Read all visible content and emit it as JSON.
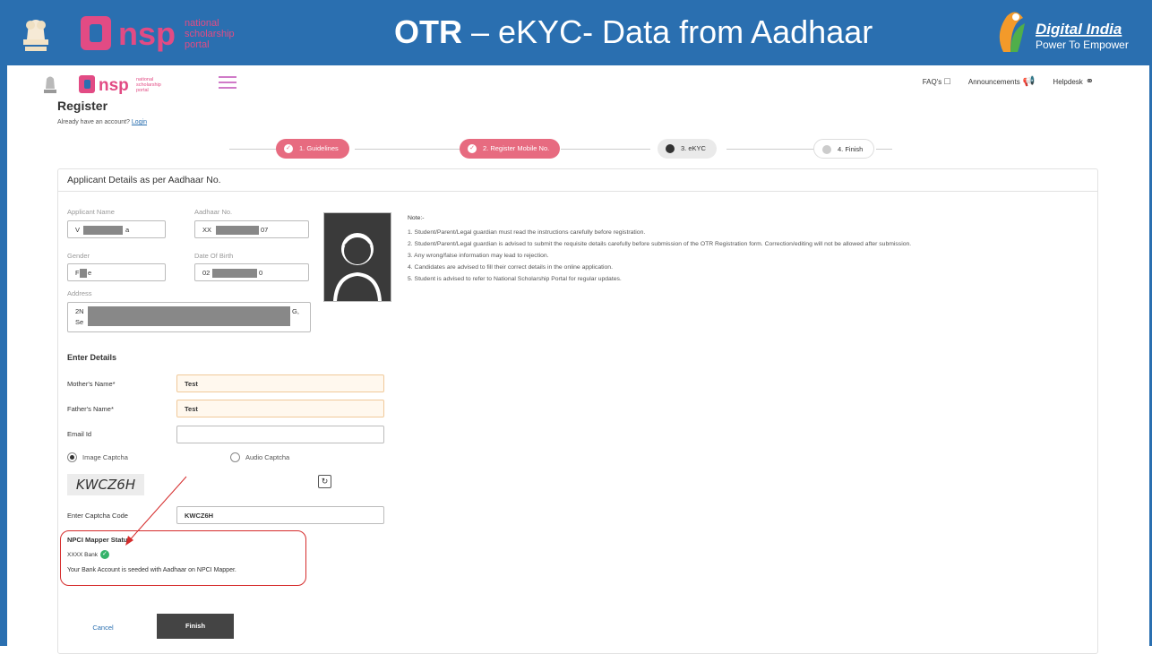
{
  "slide": {
    "title_bold": "OTR",
    "title_rest": " – eKYC- Data from Aadhaar",
    "nsp_brand": "nsp",
    "nsp_tagline_1": "national",
    "nsp_tagline_2": "scholarship",
    "nsp_tagline_3": "portal",
    "di_name": "Digital India",
    "di_tagline": "Power To Empower"
  },
  "nav": {
    "faq": "FAQ's",
    "announcements": "Announcements",
    "helpdesk": "Helpdesk"
  },
  "register": {
    "title": "Register",
    "account_prompt": "Already have an account?",
    "login_link": "Login"
  },
  "steps": [
    {
      "label": "1. Guidelines",
      "state": "done"
    },
    {
      "label": "2. Register Mobile No.",
      "state": "done"
    },
    {
      "label": "3. eKYC",
      "state": "active"
    },
    {
      "label": "4. Finish",
      "state": "todo"
    }
  ],
  "applicant": {
    "heading": "Applicant Details as per Aadhaar No.",
    "name_label": "Applicant Name",
    "name_start": "V",
    "name_end": "a",
    "aadhaar_label": "Aadhaar No.",
    "aadhaar_start": "XX",
    "aadhaar_end": "07",
    "gender_label": "Gender",
    "gender_start": "F",
    "gender_end": "e",
    "dob_label": "Date Of Birth",
    "dob_start": "02",
    "dob_end": "0",
    "address_label": "Address",
    "address_line1_start": "2N",
    "address_line1_end": "G,",
    "address_line2_start": "Se"
  },
  "notes": {
    "heading": "Note:-",
    "items": [
      "1. Student/Parent/Legal guardian must read the instructions carefully before registration.",
      "2. Student/Parent/Legal guardian is advised to submit the requisite details carefully before submission of the OTR Registration form. Correction/editing will not be allowed after submission.",
      "3. Any wrong/false information may lead to rejection.",
      "4. Candidates are advised to fill their correct details in the online application.",
      "5. Student is advised to refer to National Scholarship Portal for regular updates."
    ]
  },
  "details": {
    "heading": "Enter Details",
    "mother_label": "Mother's Name*",
    "mother_value": "Test",
    "father_label": "Father's Name*",
    "father_value": "Test",
    "email_label": "Email Id",
    "email_value": "",
    "image_captcha": "Image Captcha",
    "audio_captcha": "Audio Captcha",
    "captcha_text": "KWCZ6H",
    "captcha_label": "Enter Captcha Code",
    "captcha_value": "KWCZ6H"
  },
  "npci": {
    "title": "NPCI Mapper Status",
    "bank": "XXXX Bank",
    "message": "Your Bank Account is seeded with Aadhaar on NPCI Mapper."
  },
  "actions": {
    "cancel": "Cancel",
    "finish": "Finish"
  },
  "colors": {
    "header_blue": "#2a6fb0",
    "step_done": "#e76b80",
    "highlight_red": "#d52c2c",
    "verified_green": "#35b36a"
  }
}
